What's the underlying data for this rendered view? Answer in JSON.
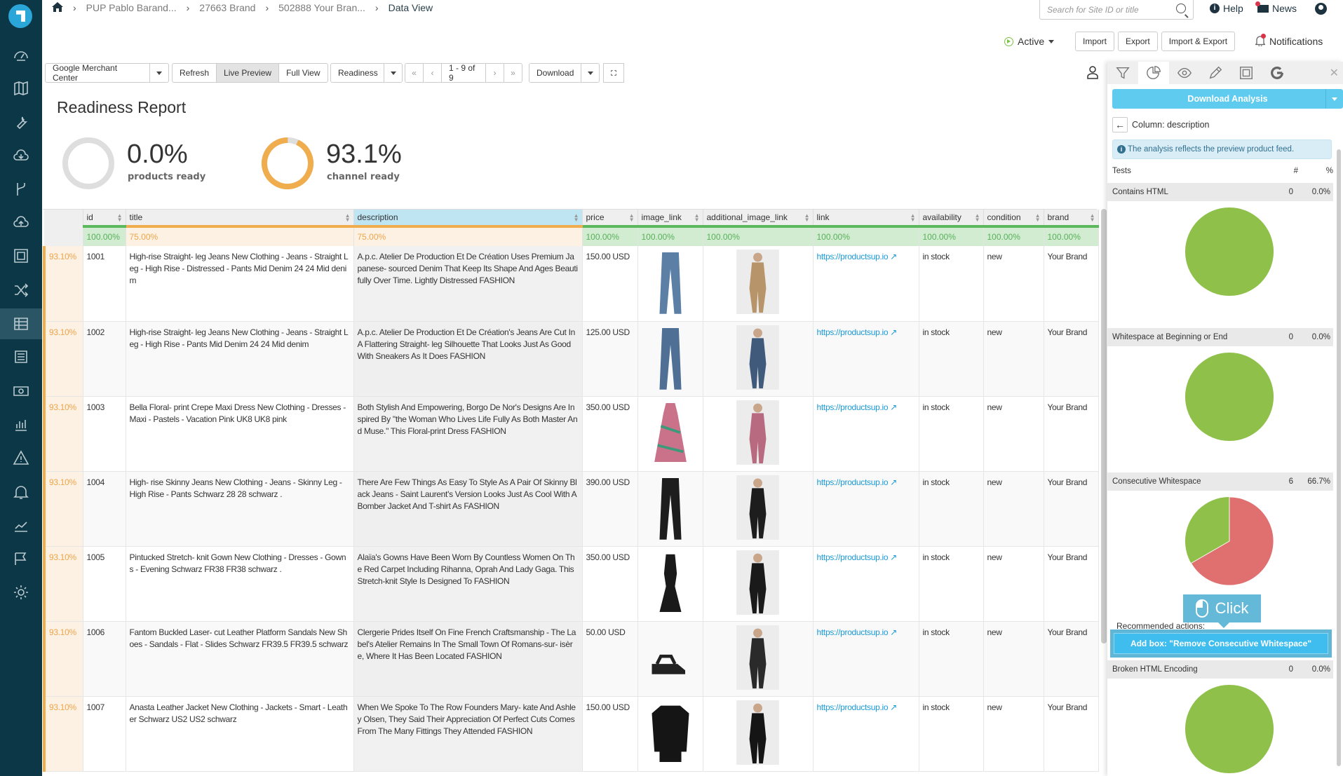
{
  "breadcrumb": [
    "PUP Pablo Barand...",
    "27663 Brand",
    "502888 Your Bran...",
    "Data View"
  ],
  "header": {
    "search_placeholder": "Search for Site ID or title",
    "help": "Help",
    "news": "News",
    "status": "Active",
    "import": "Import",
    "export": "Export",
    "import_export": "Import & Export",
    "notifications": "Notifications"
  },
  "sidebar": {
    "icons": [
      "dashboard-icon",
      "map-icon",
      "wrench-icon",
      "cloud-download-icon",
      "branch-icon",
      "cloud-upload-icon",
      "frame-icon",
      "shuffle-icon",
      "table-icon",
      "list-icon",
      "money-icon",
      "bar-chart-icon",
      "warning-icon",
      "bell-icon",
      "line-chart-icon",
      "flag-icon",
      "settings-icon"
    ],
    "active": "table-icon"
  },
  "toolbar": {
    "channel": "Google Merchant Center",
    "refresh": "Refresh",
    "live_preview": "Live Preview",
    "full_view": "Full View",
    "view_mode": "Readiness",
    "first": "«",
    "prev": "‹",
    "pager": "1 - 9 of 9",
    "next": "›",
    "last": "»",
    "download": "Download"
  },
  "report": {
    "title": "Readiness Report",
    "products_ready": {
      "value": "0.0%",
      "label": "products ready",
      "fraction": 0.0
    },
    "channel_ready": {
      "value": "93.1%",
      "label": "channel ready",
      "fraction": 0.931
    }
  },
  "colors": {
    "ok": "#5cb85c",
    "warn": "#f0ad4e",
    "pie_pass": "#8fc04a",
    "pie_fail": "#e07070",
    "accent": "#5ecbef"
  },
  "table": {
    "columns": [
      "id",
      "title",
      "description",
      "price",
      "image_link",
      "additional_image_link",
      "link",
      "availability",
      "condition",
      "brand"
    ],
    "selected_column": "description",
    "column_readiness": [
      "100.00%",
      "75.00%",
      "75.00%",
      "100.00%",
      "100.00%",
      "100.00%",
      "100.00%",
      "100.00%",
      "100.00%",
      "100.00%"
    ],
    "rows": [
      {
        "readiness": "93.10%",
        "id": "1001",
        "title": "  High-rise Straight- leg Jeans New Clothing - Jeans - Straight Leg - High Rise - Distressed - Pants Mid Denim 24 24 Mid denim",
        "description": "A.p.c. Atelier De Production Et De Création Uses Premium Japanese- sourced Denim That Keep Its Shape And Ages Beautifully Over Time. Lightly Distressed FASHION",
        "price": "150.00 USD",
        "image": "jeans",
        "image_color": "#5c7fa6",
        "model_color": "#b8946a",
        "link": "https://productsup.io",
        "availability": "in stock",
        "condition": "new",
        "brand": "Your Brand"
      },
      {
        "readiness": "93.10%",
        "id": "1002",
        "title": "  High-rise Straight- leg Jeans New Clothing - Jeans - Straight Leg - High Rise - Pants Mid Denim 24 24 Mid denim",
        "description": "A.p.c. Atelier De Production Et De Création's Jeans Are Cut In A Flattering Straight- leg Silhouette That Looks Just As Good With Sneakers As It Does  FASHION",
        "price": "125.00 USD",
        "image": "jeans",
        "image_color": "#4f6f95",
        "model_color": "#3f5a7a",
        "link": "https://productsup.io",
        "availability": "in stock",
        "condition": "new",
        "brand": "Your Brand"
      },
      {
        "readiness": "93.10%",
        "id": "1003",
        "title": "  Bella Floral- print Crepe Maxi Dress New Clothing - Dresses - Maxi - Pastels - Vacation Pink UK8 UK8 pink",
        "description": "Both Stylish And Empowering, Borgo De Nor's Designs Are Inspired By \"the Woman Who Lives Life Fully As Both Master And Muse.\" This Floral-print Dress  FASHION",
        "price": "350.00 USD",
        "image": "dress",
        "image_color": "#c9728a",
        "model_color": "#b86a80",
        "link": "https://productsup.io",
        "availability": "in stock",
        "condition": "new",
        "brand": "Your Brand"
      },
      {
        "readiness": "93.10%",
        "id": "1004",
        "title": "  High- rise Skinny Jeans New Clothing - Jeans - Skinny Leg - High Rise - Pants Schwarz 28 28 schwarz .",
        "description": "There Are Few Things As Easy To Style As A Pair Of Skinny Black Jeans - Saint Laurent's Version Looks Just As Cool With A Bomber Jacket And T-shirt As FASHION",
        "price": "390.00 USD",
        "image": "jeans",
        "image_color": "#1d1d1d",
        "model_color": "#1d1d1d",
        "link": "https://productsup.io",
        "availability": "in stock",
        "condition": "new",
        "brand": "Your Brand"
      },
      {
        "readiness": "93.10%",
        "id": "1005",
        "title": "  Pintucked Stretch- knit Gown New Clothing - Dresses - Gowns - Evening Schwarz FR38 FR38 schwarz .",
        "description": "Alaïa's Gowns Have Been Worn By Countless Women On The Red Carpet Including Rihanna, Oprah And Lady Gaga. This Stretch-knit Style Is Designed To FASHION",
        "price": "350.00 USD",
        "image": "gown",
        "image_color": "#1a1a1a",
        "model_color": "#1a1a1a",
        "link": "https://productsup.io",
        "availability": "in stock",
        "condition": "new",
        "brand": "Your Brand"
      },
      {
        "readiness": "93.10%",
        "id": "1006",
        "title": "Fantom Buckled Laser- cut Leather Platform Sandals New Shoes - Sandals - Flat - Slides Schwarz FR39.5 FR39.5 schwarz",
        "description": "Clergerie Prides Itself On Fine French Craftsmanship - The Label's Atelier Remains In The Small Town Of Romans-sur- isère, Where It Has Been Located  FASHION",
        "price": "50.00 USD",
        "image": "sandals",
        "image_color": "#222222",
        "model_color": "#2a2a2a",
        "link": "https://productsup.io",
        "availability": "in stock",
        "condition": "new",
        "brand": "Your Brand"
      },
      {
        "readiness": "93.10%",
        "id": "1007",
        "title": "  Anasta Leather Jacket New Clothing - Jackets - Smart - Leather Schwarz US2 US2 schwarz",
        "description": "When We Spoke To The Row Founders Mary- kate And Ashley Olsen, They Said Their Appreciation Of Perfect Cuts Comes From The Many Fittings They Attended  FASHION",
        "price": "150.00 USD",
        "image": "jacket",
        "image_color": "#151515",
        "model_color": "#151515",
        "link": "https://productsup.io",
        "availability": "in stock",
        "condition": "new",
        "brand": "Your Brand"
      }
    ]
  },
  "panel": {
    "tabs": [
      "filter-icon",
      "pie-chart-icon",
      "eye-icon",
      "pencil-icon",
      "frame-icon",
      "google-icon"
    ],
    "download_analysis": "Download Analysis",
    "column_label": "Column: description",
    "info": "The analysis reflects the preview product feed.",
    "tests_header": {
      "name": "Tests",
      "count": "#",
      "percent": "%"
    },
    "total_products": 9,
    "tests": [
      {
        "name": "Contains HTML",
        "count": "0",
        "percent": "0.0%",
        "failed": 0
      },
      {
        "name": "Whitespace at Beginning or End",
        "count": "0",
        "percent": "0.0%",
        "failed": 0
      },
      {
        "name": "Consecutive Whitespace",
        "count": "6",
        "percent": "66.7%",
        "failed": 6
      },
      {
        "name": "Broken HTML Encoding",
        "count": "0",
        "percent": "0.0%",
        "failed": 0
      }
    ],
    "recommended_actions": "Recommended actions:",
    "add_box": "Add box: \"Remove Consecutive Whitespace\"",
    "click_hint": "Click"
  }
}
